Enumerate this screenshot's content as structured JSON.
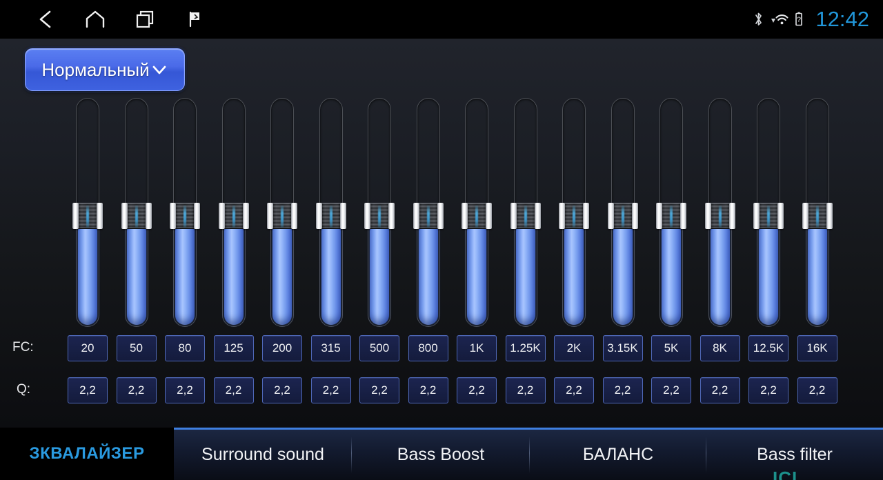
{
  "statusbar": {
    "nav": [
      {
        "name": "back-icon",
        "label": "Back"
      },
      {
        "name": "home-icon",
        "label": "Home"
      },
      {
        "name": "recents-icon",
        "label": "Recents"
      },
      {
        "name": "flag-icon",
        "label": "Flag"
      }
    ],
    "icons": [
      {
        "name": "bluetooth-icon",
        "label": "Bluetooth"
      },
      {
        "name": "wifi-icon",
        "label": "Wi-Fi"
      },
      {
        "name": "battery-unknown-icon",
        "label": "Battery unknown"
      }
    ],
    "time": "12:42"
  },
  "preset": {
    "label": "Нормальный",
    "chevron": "chevron-down-icon"
  },
  "equalizer": {
    "fc_label": "FC:",
    "q_label": "Q:",
    "bands": [
      {
        "fc": "20",
        "q": "2,2",
        "value": 50
      },
      {
        "fc": "50",
        "q": "2,2",
        "value": 50
      },
      {
        "fc": "80",
        "q": "2,2",
        "value": 50
      },
      {
        "fc": "125",
        "q": "2,2",
        "value": 50
      },
      {
        "fc": "200",
        "q": "2,2",
        "value": 50
      },
      {
        "fc": "315",
        "q": "2,2",
        "value": 50
      },
      {
        "fc": "500",
        "q": "2,2",
        "value": 50
      },
      {
        "fc": "800",
        "q": "2,2",
        "value": 50
      },
      {
        "fc": "1K",
        "q": "2,2",
        "value": 50
      },
      {
        "fc": "1.25K",
        "q": "2,2",
        "value": 50
      },
      {
        "fc": "2K",
        "q": "2,2",
        "value": 50
      },
      {
        "fc": "3.15K",
        "q": "2,2",
        "value": 50
      },
      {
        "fc": "5K",
        "q": "2,2",
        "value": 50
      },
      {
        "fc": "8K",
        "q": "2,2",
        "value": 50
      },
      {
        "fc": "12.5K",
        "q": "2,2",
        "value": 50
      },
      {
        "fc": "16K",
        "q": "2,2",
        "value": 50
      }
    ]
  },
  "tabs": [
    {
      "label": "ЗКВАЛАЙЗЕР",
      "active": true
    },
    {
      "label": "Surround sound",
      "active": false
    },
    {
      "label": "Bass Boost",
      "active": false
    },
    {
      "label": "БАЛАНС",
      "active": false
    },
    {
      "label": "Bass filter",
      "active": false
    }
  ],
  "watermark": "ICL",
  "colors": {
    "accent_blue": "#2a9ae0",
    "clock_blue": "#2196d9",
    "slider_fill": "#7ba2f5",
    "preset_blue": "#4a6ae8",
    "cell_border": "#4f68b8"
  }
}
